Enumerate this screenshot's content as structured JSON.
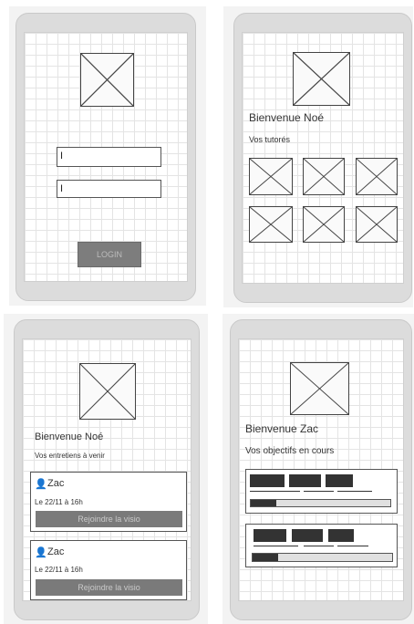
{
  "login": {
    "username_value": "I",
    "password_value": "I",
    "button_label": "LOGIN"
  },
  "tutor_home": {
    "welcome": "Bienvenue Noé",
    "subtitle": "Vos tutorés"
  },
  "interviews": {
    "welcome": "Bienvenue Noé",
    "subtitle": "Vos entretiens à venir",
    "cards": [
      {
        "name": "Zac",
        "date": "Le 22/11 à 16h",
        "join_label": "Rejoindre la visio"
      },
      {
        "name": "Zac",
        "date": "Le 22/11 à 16h",
        "join_label": "Rejoindre la visio"
      }
    ]
  },
  "objectives": {
    "welcome": "Bienvenue Zac",
    "subtitle": "Vos objectifs en cours",
    "items": [
      {
        "progress": 0.18
      },
      {
        "progress": 0.18
      }
    ]
  },
  "icons": {
    "placeholder": "image-placeholder-icon",
    "user": "user-icon"
  }
}
